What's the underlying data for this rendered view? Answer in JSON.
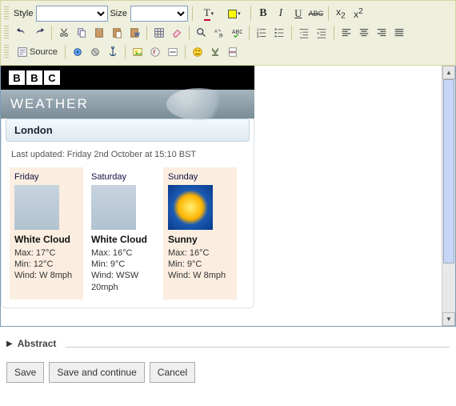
{
  "toolbar": {
    "style_label": "Style",
    "size_label": "Size",
    "bold": "B",
    "italic": "I",
    "underline": "U",
    "strike": "ABC",
    "sub": "x₂",
    "sup": "x²",
    "source_label": "Source"
  },
  "widget": {
    "brand": [
      "B",
      "B",
      "C"
    ],
    "product": "WEATHER",
    "location": "London",
    "updated": "Last updated: Friday 2nd October at 15:10 BST",
    "days": [
      {
        "name": "Friday",
        "cond": "White Cloud",
        "max": "Max: 17°C",
        "min": "Min: 12°C",
        "wind": "Wind: W 8mph"
      },
      {
        "name": "Saturday",
        "cond": "White Cloud",
        "max": "Max: 16°C",
        "min": "Min: 9°C",
        "wind": "Wind: WSW 20mph"
      },
      {
        "name": "Sunday",
        "cond": "Sunny",
        "max": "Max: 16°C",
        "min": "Min: 9°C",
        "wind": "Wind: W 8mph"
      }
    ]
  },
  "section": {
    "abstract": "Abstract"
  },
  "buttons": {
    "save": "Save",
    "save_cont": "Save and continue",
    "cancel": "Cancel"
  }
}
